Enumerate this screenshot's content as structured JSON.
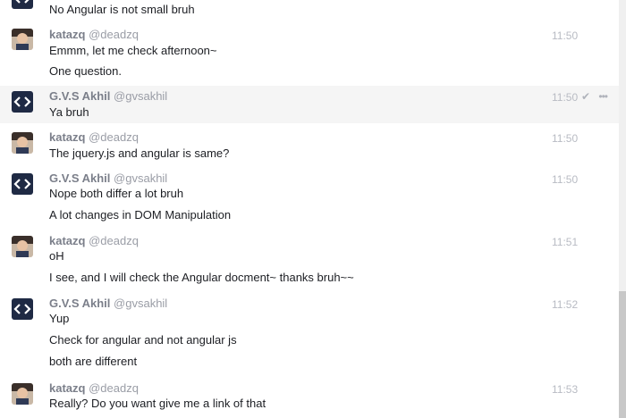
{
  "colors": {
    "akhil_avatar_bg": "#1f2a44",
    "highlight_row": "#f5f5f5",
    "timestamp": "#b8bbc3"
  },
  "messages": [
    {
      "author": "",
      "handle": "",
      "time": "",
      "avatar": "code-brackets-avatar",
      "lines": [
        "No Angular is not small bruh"
      ]
    },
    {
      "author": "katazq",
      "handle": "@deadzq",
      "time": "11:50",
      "avatar": "user-photo-avatar",
      "lines": [
        "Emmm, let me check afternoon~",
        "One question."
      ]
    },
    {
      "author": "G.V.S Akhil",
      "handle": "@gvsakhil",
      "time": "11:50",
      "avatar": "code-brackets-avatar",
      "lines": [
        "Ya bruh"
      ],
      "actions": "✔ •••"
    },
    {
      "author": "katazq",
      "handle": "@deadzq",
      "time": "11:50",
      "avatar": "user-photo-avatar",
      "lines": [
        "The jquery.js and angular is same?"
      ]
    },
    {
      "author": "G.V.S Akhil",
      "handle": "@gvsakhil",
      "time": "11:50",
      "avatar": "code-brackets-avatar",
      "lines": [
        "Nope both differ a lot bruh",
        "A lot changes in DOM Manipulation"
      ]
    },
    {
      "author": "katazq",
      "handle": "@deadzq",
      "time": "11:51",
      "avatar": "user-photo-avatar",
      "lines": [
        "oH",
        "I see, and I will check the Angular docment~ thanks bruh~~"
      ]
    },
    {
      "author": "G.V.S Akhil",
      "handle": "@gvsakhil",
      "time": "11:52",
      "avatar": "code-brackets-avatar",
      "lines": [
        "Yup",
        "Check for angular and not angular js",
        "both are different"
      ]
    },
    {
      "author": "katazq",
      "handle": "@deadzq",
      "time": "11:53",
      "avatar": "user-photo-avatar",
      "lines": [
        "Really? Do you want give me a link of that"
      ]
    }
  ]
}
